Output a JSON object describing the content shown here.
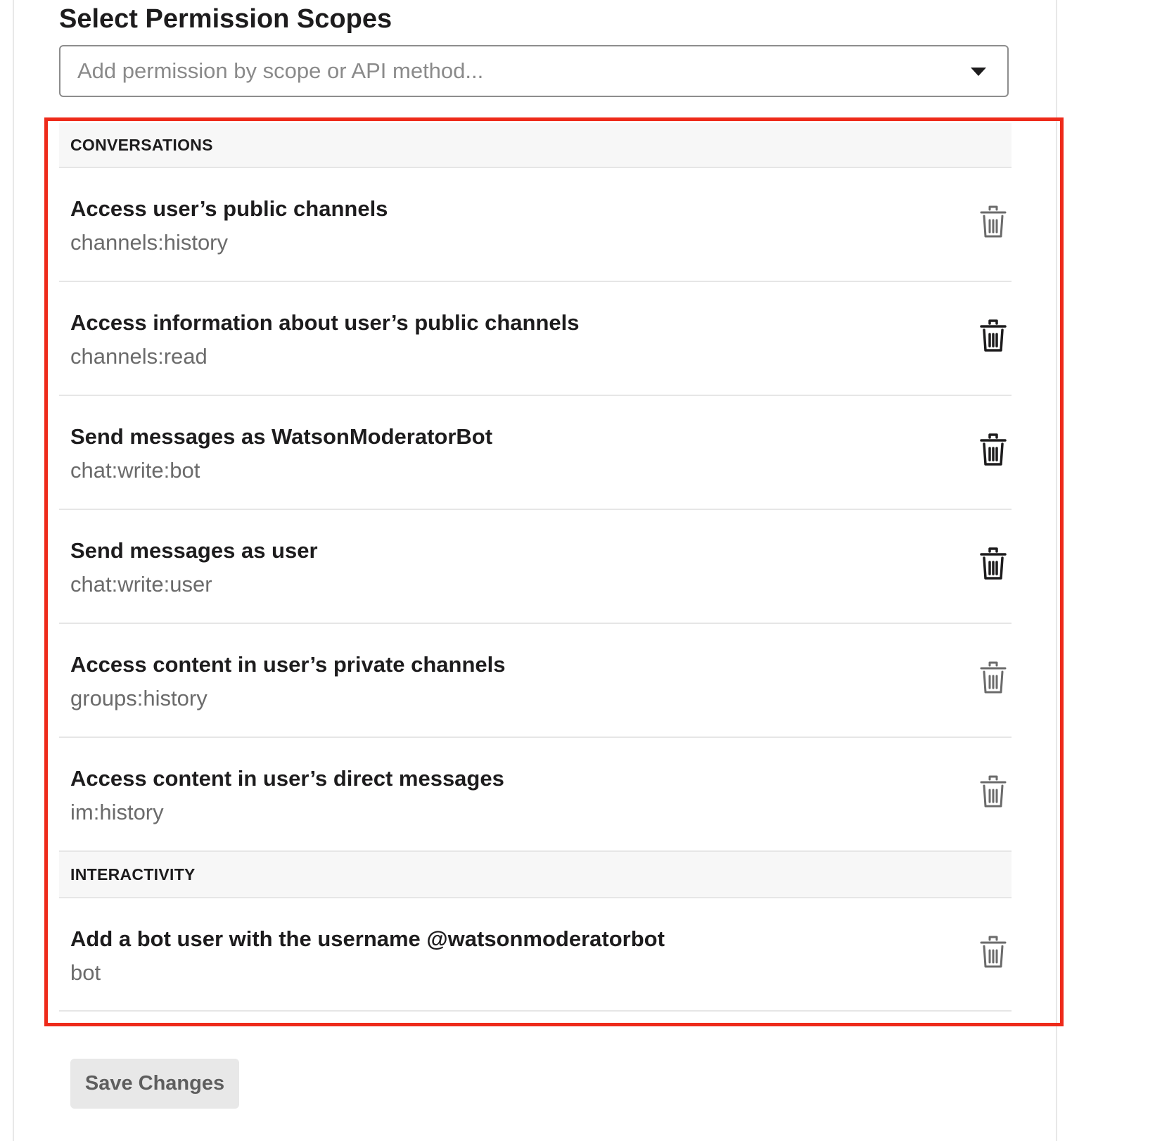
{
  "page": {
    "title": "Select Permission Scopes"
  },
  "search": {
    "placeholder": "Add permission by scope or API method...",
    "icon": "caret-down-icon"
  },
  "groups": [
    {
      "label": "CONVERSATIONS",
      "scopes": [
        {
          "title": "Access user’s public channels",
          "scope": "channels:history",
          "icon": "trash-icon",
          "icon_color": "#6b6b6b"
        },
        {
          "title": "Access information about user’s public channels",
          "scope": "channels:read",
          "icon": "trash-icon",
          "icon_color": "#1d1c1d"
        },
        {
          "title": "Send messages as WatsonModeratorBot",
          "scope": "chat:write:bot",
          "icon": "trash-icon",
          "icon_color": "#1d1c1d"
        },
        {
          "title": "Send messages as user",
          "scope": "chat:write:user",
          "icon": "trash-icon",
          "icon_color": "#1d1c1d"
        },
        {
          "title": "Access content in user’s private channels",
          "scope": "groups:history",
          "icon": "trash-icon",
          "icon_color": "#6b6b6b"
        },
        {
          "title": "Access content in user’s direct messages",
          "scope": "im:history",
          "icon": "trash-icon",
          "icon_color": "#6b6b6b"
        }
      ]
    },
    {
      "label": "INTERACTIVITY",
      "scopes": [
        {
          "title": "Add a bot user with the username @watsonmoderatorbot",
          "scope": "bot",
          "icon": "trash-icon",
          "icon_color": "#6b6b6b"
        }
      ]
    }
  ],
  "actions": {
    "save_label": "Save Changes"
  },
  "colors": {
    "highlight_border": "#ee2a1a",
    "header_bg": "#f7f7f7",
    "button_bg": "#e8e8e8"
  }
}
